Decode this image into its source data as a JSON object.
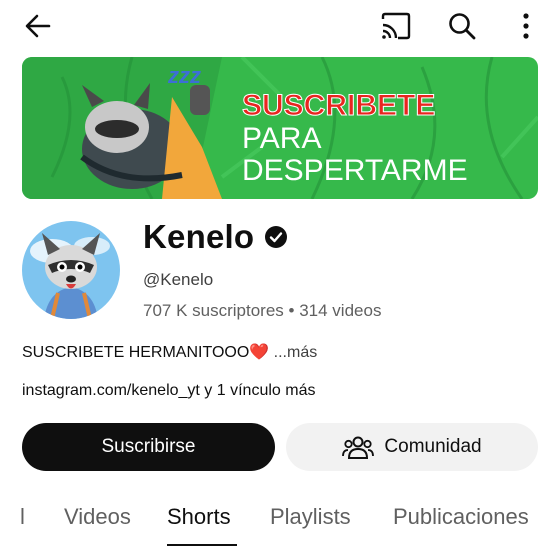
{
  "topbar": {
    "back_icon": "arrow-left-icon",
    "cast_icon": "cast-icon",
    "search_icon": "search-icon",
    "more_icon": "more-vertical-icon"
  },
  "banner": {
    "line1": "SUSCRIBETE",
    "line2": "PARA",
    "line3": "DESPERTARME",
    "zzz": "zzz",
    "accent_color": "#e8261f",
    "background_color": "#35b84a"
  },
  "channel": {
    "name": "Kenelo",
    "handle": "@Kenelo",
    "subscribers": "707 K suscriptores",
    "separator": "•",
    "videos": "314 videos",
    "description": "SUSCRIBETE HERMANITOOO",
    "description_emoji": "❤️",
    "description_more": " ...más",
    "links": "instagram.com/kenelo_yt y 1 vínculo más"
  },
  "actions": {
    "subscribe_label": "Suscribirse",
    "community_label": "Comunidad",
    "community_icon": "people-icon"
  },
  "tabs": [
    {
      "label": "l"
    },
    {
      "label": "Videos"
    },
    {
      "label": "Shorts",
      "active": true
    },
    {
      "label": "Playlists"
    },
    {
      "label": "Publicaciones"
    }
  ]
}
